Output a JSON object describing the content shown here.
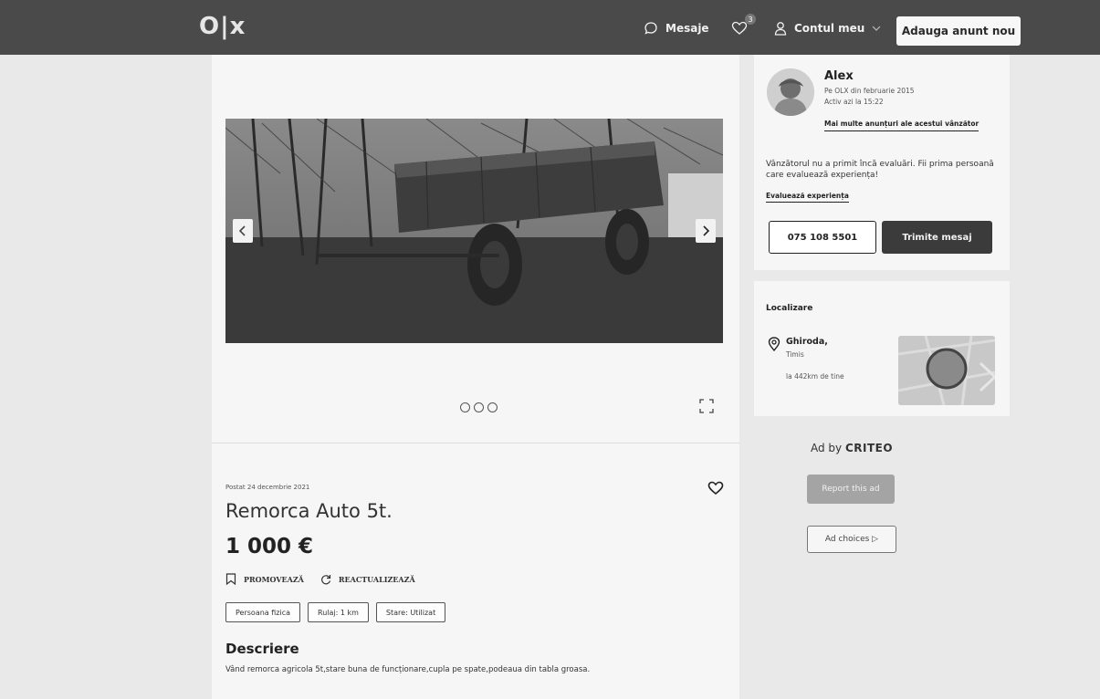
{
  "header": {
    "logo": "O|x",
    "messages_label": "Mesaje",
    "favorites_count": "3",
    "account_label": "Contul meu",
    "post_ad_label": "Adauga anunt nou"
  },
  "listing": {
    "posted_date": "Postat 24 decembrie 2021",
    "title": "Remorca Auto 5t.",
    "price": "1 000 €",
    "promote_label": "PROMOVEAZĂ",
    "refresh_label": "REACTUALIZEAZĂ",
    "tags": [
      "Persoana fizica",
      "Rulaj: 1 km",
      "Stare: Utilizat"
    ],
    "description_heading": "Descriere",
    "description": "Vând remorca agricola 5t,stare buna de funcționare,cupla pe spate,podeaua din tabla groasa."
  },
  "seller": {
    "name": "Alex",
    "member_since": "Pe OLX din februarie 2015",
    "last_active": "Activ azi la 15:22",
    "more_ads_link": "Mai multe anunțuri ale acestui vânzător",
    "rating_text": "Vânzătorul nu a primit încă evaluări. Fii prima persoană care evaluează experiența!",
    "rate_link": "Evaluează experiența",
    "phone_label": "075 108 5501",
    "message_label": "Trimite mesaj"
  },
  "location": {
    "heading": "Localizare",
    "city": "Ghiroda,",
    "region": "Timis",
    "distance": "la 442km de tine"
  },
  "ads": {
    "ad_by_prefix": "Ad by",
    "ad_by_brand": "CRITEO",
    "report_label": "Report this ad",
    "choices_label": "Ad choices ▷"
  },
  "colors": {
    "header_bg": "#4a4a4a",
    "primary_button": "#3b3b3b"
  }
}
